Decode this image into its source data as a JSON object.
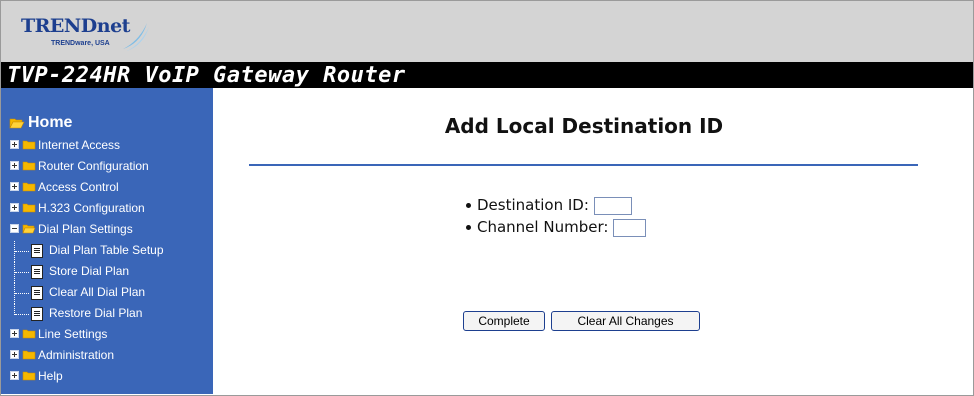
{
  "brand": {
    "name": "TRENDnet",
    "tagline": "TRENDware, USA"
  },
  "header": {
    "title": "TVP-224HR VoIP Gateway Router"
  },
  "sidebar": {
    "home_label": "Home",
    "items": [
      {
        "label": "Internet Access",
        "type": "folder",
        "expanded": false
      },
      {
        "label": "Router Configuration",
        "type": "folder",
        "expanded": false
      },
      {
        "label": "Access Control",
        "type": "folder",
        "expanded": false
      },
      {
        "label": "H.323 Configuration",
        "type": "folder",
        "expanded": false
      },
      {
        "label": "Dial Plan Settings",
        "type": "folder",
        "expanded": true
      },
      {
        "label": "Dial Plan Table Setup",
        "type": "page"
      },
      {
        "label": "Store Dial Plan",
        "type": "page"
      },
      {
        "label": "Clear All Dial Plan",
        "type": "page"
      },
      {
        "label": "Restore Dial Plan",
        "type": "page"
      },
      {
        "label": "Line Settings",
        "type": "folder",
        "expanded": false
      },
      {
        "label": "Administration",
        "type": "folder",
        "expanded": false
      },
      {
        "label": "Help",
        "type": "folder",
        "expanded": false
      }
    ]
  },
  "main": {
    "title": "Add Local Destination ID",
    "fields": {
      "destination_id": {
        "label": "Destination ID:",
        "value": ""
      },
      "channel_number": {
        "label": "Channel Number:",
        "value": ""
      }
    },
    "buttons": {
      "complete": "Complete",
      "clear_all": "Clear All Changes"
    }
  },
  "colors": {
    "sidebar_bg": "#3a66b8",
    "header_bg": "#d4d4d4",
    "titlebar_bg": "#000000",
    "rule": "#3a66b8",
    "folder": "#f5b800"
  }
}
